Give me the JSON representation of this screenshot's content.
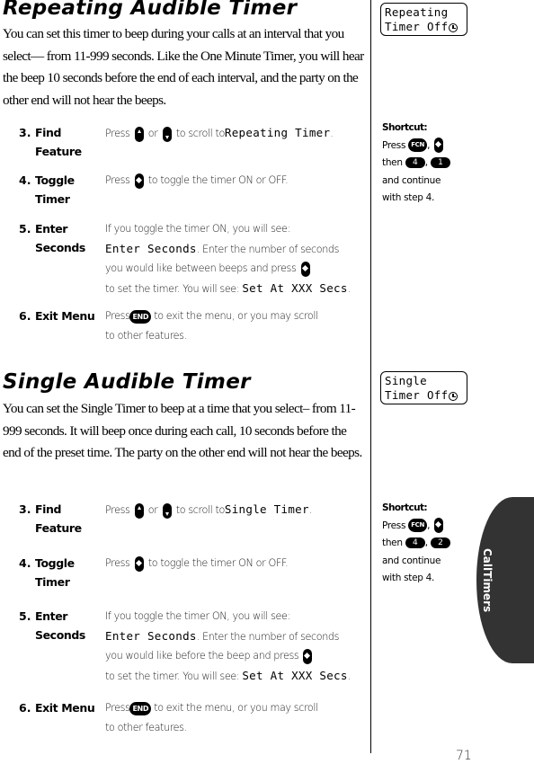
{
  "page_number": "71",
  "side_tab": "CallTimers",
  "sections": [
    {
      "title": "Repeating Audible Timer",
      "intro": "You can set this timer to beep during your calls at an interval that you select— from 11-999 seconds. Like the One Minute Timer, you will hear the beep 10 seconds before the end of each interval, and the party on the other end will not hear the beeps.",
      "display": {
        "line1": "Repeating",
        "line2": "Timer Off",
        "icon": "clock-icon"
      },
      "shortcut": {
        "title": "Shortcut:",
        "press": "Press",
        "fcn_key": "FCN",
        "then": "then",
        "key_a": "4",
        "key_b": "1",
        "continue": "and continue",
        "with_step": "with step 4."
      },
      "steps": [
        {
          "num": "3.",
          "label": "Find Feature",
          "pre": "Press",
          "or": "or",
          "post": "to scroll to",
          "lcd": "Repeating Timer",
          "end": "."
        },
        {
          "num": "4.",
          "label": "Toggle Timer",
          "pre": "Press",
          "post": "to toggle the timer ON or OFF."
        },
        {
          "num": "5.",
          "label": "Enter Seconds",
          "line1": "If you toggle the timer ON, you will see:",
          "lcd1": "Enter Seconds",
          "line2": ". Enter the number of seconds",
          "line3": "you would like between beeps and press",
          "line4": "to set the timer. You will see:",
          "lcd2": "Set At XXX Secs",
          "end": "."
        },
        {
          "num": "6.",
          "label": "Exit Menu",
          "pre": "Press",
          "key": "END",
          "post": "to exit the menu, or you may scroll",
          "line2": "to other features."
        }
      ]
    },
    {
      "title": "Single Audible Timer",
      "intro": "You can set the Single Timer to beep at a time that you select– from 11-999 seconds. It will beep once during each call, 10 seconds before the end of the preset time. The party on the other end will not hear the beeps.",
      "display": {
        "line1": "Single",
        "line2": "Timer Off",
        "icon": "clock-icon"
      },
      "shortcut": {
        "title": "Shortcut:",
        "press": "Press",
        "fcn_key": "FCN",
        "then": "then",
        "key_a": "4",
        "key_b": "2",
        "continue": "and continue",
        "with_step": "with step 4."
      },
      "steps": [
        {
          "num": "3.",
          "label": "Find Feature",
          "pre": "Press",
          "or": "or",
          "post": "to scroll to",
          "lcd": "Single Timer",
          "end": "."
        },
        {
          "num": "4.",
          "label": "Toggle Timer",
          "pre": "Press",
          "post": "to toggle the timer ON or OFF."
        },
        {
          "num": "5.",
          "label": "Enter Seconds",
          "line1": "If you toggle the timer ON, you will see:",
          "lcd1": "Enter Seconds",
          "line2": ". Enter the number of seconds",
          "line3": "you would like before the beep and press",
          "line4": "to set the timer. You will see:",
          "lcd2": "Set At XXX Secs",
          "end": "."
        },
        {
          "num": "6.",
          "label": "Exit Menu",
          "pre": "Press",
          "key": "END",
          "post": "to exit the menu, or you may scroll",
          "line2": "to other features."
        }
      ]
    }
  ]
}
